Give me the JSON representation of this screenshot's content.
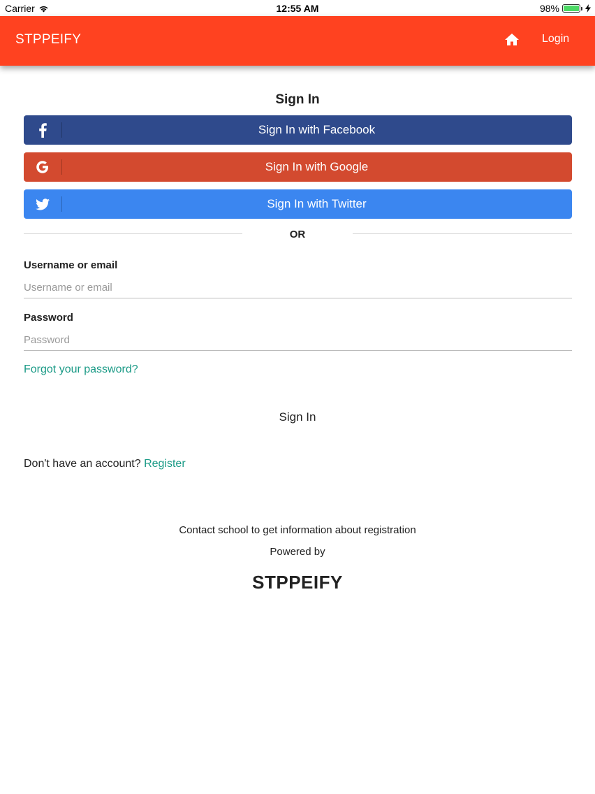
{
  "status_bar": {
    "carrier": "Carrier",
    "time": "12:55 AM",
    "battery": "98%"
  },
  "navbar": {
    "brand": "STPPEIFY",
    "home_icon": "home-icon",
    "login_label": "Login",
    "color": "#ff4220"
  },
  "signin": {
    "title": "Sign In",
    "social": {
      "facebook": {
        "label": "Sign In with Facebook",
        "icon": "facebook-icon",
        "color": "#2f4a8c"
      },
      "google": {
        "label": "Sign In with Google",
        "icon": "google-icon",
        "color": "#d34a2f"
      },
      "twitter": {
        "label": "Sign In with Twitter",
        "icon": "twitter-icon",
        "color": "#3b86f0"
      }
    },
    "or_text": "OR",
    "username": {
      "label": "Username or email",
      "placeholder": "Username or email",
      "value": ""
    },
    "password": {
      "label": "Password",
      "placeholder": "Password",
      "value": ""
    },
    "forgot_link": "Forgot your password?",
    "submit_label": "Sign In",
    "no_account_text": "Don't have an account?",
    "register_link": "Register"
  },
  "footer": {
    "contact": "Contact school to get information about registration",
    "powered_by": "Powered by",
    "logo": "STPPEIFY"
  },
  "link_color": "#1a9a86"
}
